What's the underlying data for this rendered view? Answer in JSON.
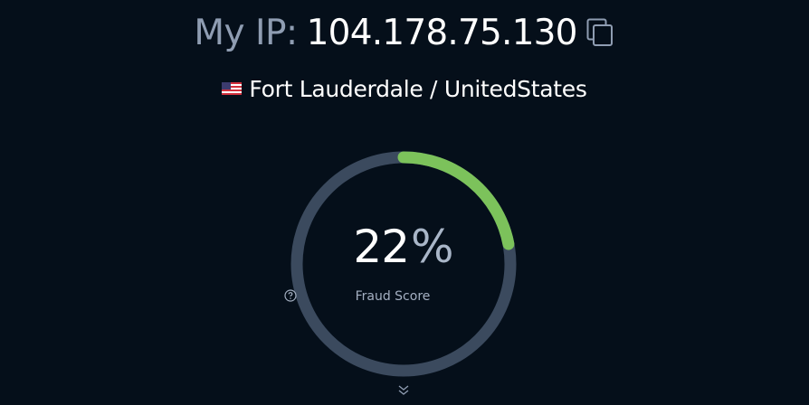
{
  "header": {
    "ip_prefix": "My IP:",
    "ip_value": "104.178.75.130",
    "copy_icon": "copy-icon"
  },
  "location": {
    "flag_icon": "us-flag-icon",
    "text": "Fort Lauderdale / UnitedStates"
  },
  "fraud_score": {
    "value": "22",
    "unit": "%",
    "fraction": 0.22,
    "label": "Fraud Score",
    "help_icon": "help-circle-icon"
  },
  "footer": {
    "scroll_icon": "chevron-double-down-icon"
  },
  "colors": {
    "background": "#050f1a",
    "track": "#3b4a5e",
    "progress": "#7cc25b",
    "muted_text": "#8f9db2"
  }
}
